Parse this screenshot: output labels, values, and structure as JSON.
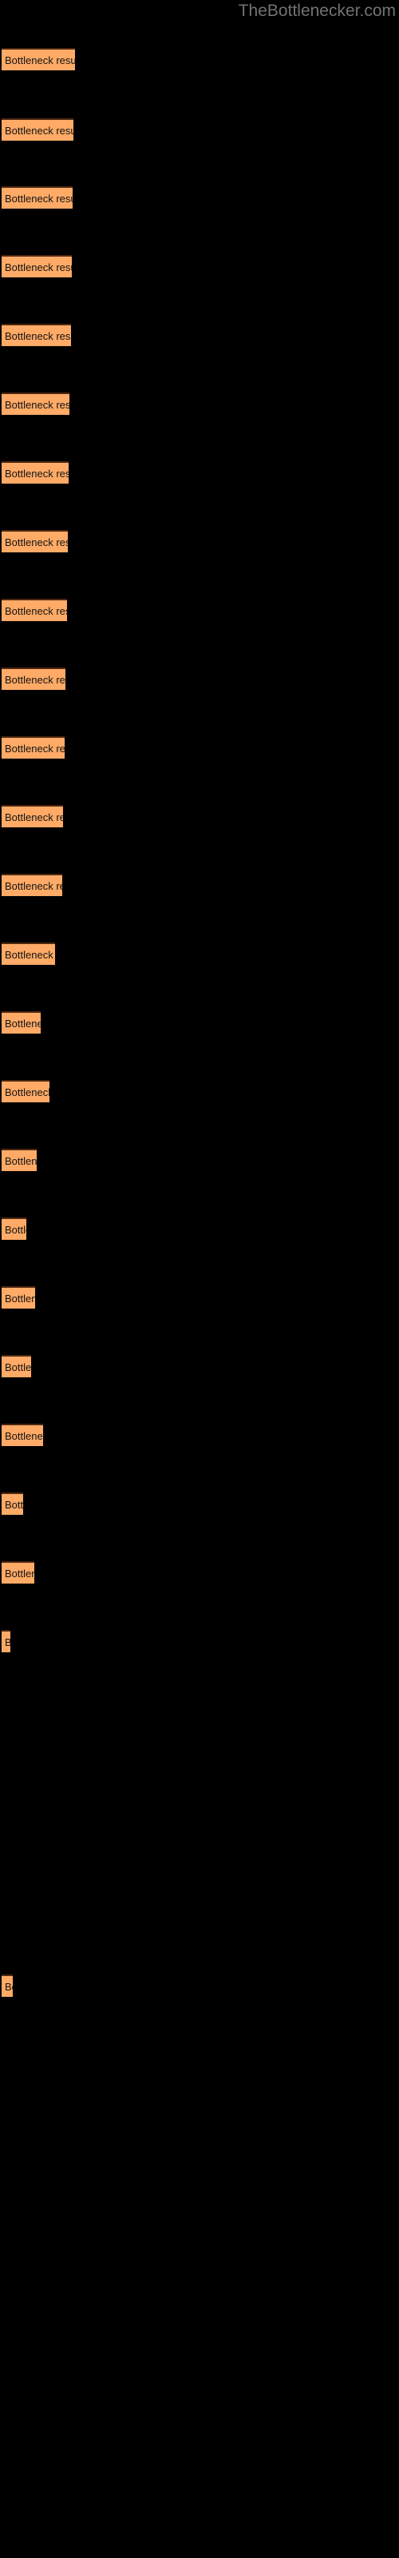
{
  "site": {
    "watermark": "TheBottlenecker.com"
  },
  "chart_data": {
    "type": "bar",
    "orientation": "horizontal",
    "title": "",
    "subtitle": "",
    "xlabel": "",
    "ylabel": "",
    "grid": false,
    "legend": null,
    "background_color": "#000000",
    "bar_color": "#ffaa66",
    "bar_border_color": "#4d2610",
    "label_color": "#141414",
    "watermark_color": "#727272",
    "bar_label_text": "Bottleneck result",
    "xlim": [
      0,
      100
    ],
    "categories": [
      "Bottleneck result",
      "Bottleneck result",
      "Bottleneck result",
      "Bottleneck result",
      "Bottleneck result",
      "Bottleneck result",
      "Bottleneck result",
      "Bottleneck result",
      "Bottleneck result",
      "Bottleneck result",
      "Bottleneck result",
      "Bottleneck result",
      "Bottleneck result",
      "Bottleneck result",
      "Bottleneck result",
      "Bottleneck result",
      "Bottleneck result",
      "Bottleneck result",
      "Bottleneck result",
      "Bottleneck result",
      "Bottleneck result",
      "Bottleneck result",
      "Bottleneck result",
      "Bottleneck result",
      "Bottleneck result",
      "Bottleneck result"
    ],
    "values": [
      92,
      90,
      89,
      88,
      87,
      85,
      84,
      83,
      82,
      80,
      79,
      77,
      76,
      68,
      54,
      64,
      50,
      42,
      48,
      45,
      62,
      40,
      44,
      10,
      0,
      12
    ],
    "bars": [
      {
        "index": 1,
        "y": 60,
        "width": 92,
        "label": "Bottleneck result"
      },
      {
        "index": 2,
        "y": 148,
        "width": 90,
        "label": "Bottleneck result"
      },
      {
        "index": 3,
        "y": 233,
        "width": 89,
        "label": "Bottleneck result"
      },
      {
        "index": 4,
        "y": 319,
        "width": 88,
        "label": "Bottleneck result"
      },
      {
        "index": 5,
        "y": 405,
        "width": 87,
        "label": "Bottleneck result"
      },
      {
        "index": 6,
        "y": 491,
        "width": 85,
        "label": "Bottleneck result"
      },
      {
        "index": 7,
        "y": 577,
        "width": 84,
        "label": "Bottleneck result"
      },
      {
        "index": 8,
        "y": 663,
        "width": 83,
        "label": "Bottleneck result"
      },
      {
        "index": 9,
        "y": 749,
        "width": 82,
        "label": "Bottleneck result"
      },
      {
        "index": 10,
        "y": 835,
        "width": 80,
        "label": "Bottleneck result"
      },
      {
        "index": 11,
        "y": 921,
        "width": 79,
        "label": "Bottleneck result"
      },
      {
        "index": 12,
        "y": 1007,
        "width": 77,
        "label": "Bottleneck result"
      },
      {
        "index": 13,
        "y": 1093,
        "width": 76,
        "label": "Bottleneck result"
      },
      {
        "index": 14,
        "y": 1179,
        "width": 67,
        "label": "Bottleneck result"
      },
      {
        "index": 15,
        "y": 1265,
        "width": 49,
        "label": "Bottleneck result"
      },
      {
        "index": 16,
        "y": 1351,
        "width": 60,
        "label": "Bottleneck result"
      },
      {
        "index": 17,
        "y": 1437,
        "width": 44,
        "label": "Bottleneck result"
      },
      {
        "index": 18,
        "y": 1523,
        "width": 31,
        "label": "Bottleneck result"
      },
      {
        "index": 19,
        "y": 1609,
        "width": 42,
        "label": "Bottleneck result"
      },
      {
        "index": 20,
        "y": 1695,
        "width": 37,
        "label": "Bottleneck result"
      },
      {
        "index": 21,
        "y": 1781,
        "width": 52,
        "label": "Bottleneck result"
      },
      {
        "index": 22,
        "y": 1867,
        "width": 27,
        "label": "Bottleneck result"
      },
      {
        "index": 23,
        "y": 1953,
        "width": 41,
        "label": "Bottleneck result"
      },
      {
        "index": 24,
        "y": 2039,
        "width": 11,
        "label": "Bottleneck result"
      },
      {
        "index": 25,
        "y": 2470,
        "width": 14,
        "label": "Bottleneck result"
      }
    ]
  }
}
